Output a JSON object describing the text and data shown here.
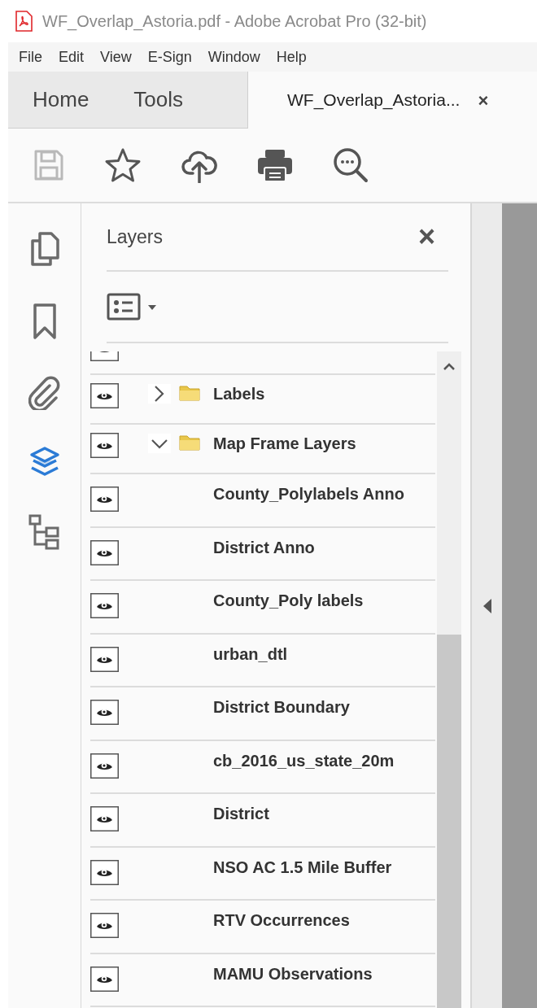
{
  "window": {
    "title": "WF_Overlap_Astoria.pdf - Adobe Acrobat Pro (32-bit)"
  },
  "menu": [
    "File",
    "Edit",
    "View",
    "E-Sign",
    "Window",
    "Help"
  ],
  "tabs": [
    {
      "label": "Home",
      "kind": "nav",
      "selected": false
    },
    {
      "label": "Tools",
      "kind": "nav",
      "selected": false
    },
    {
      "label": "WF_Overlap_Astoria...",
      "kind": "document",
      "selected": true,
      "close": "×"
    }
  ],
  "toolbar": [
    {
      "kind": "save",
      "disabled": true
    },
    {
      "kind": "star",
      "disabled": false
    },
    {
      "kind": "upload",
      "disabled": false
    },
    {
      "kind": "print",
      "disabled": false
    },
    {
      "kind": "zoom",
      "disabled": false
    }
  ],
  "rail": [
    {
      "kind": "pages",
      "selected": false
    },
    {
      "kind": "bookmark",
      "selected": false
    },
    {
      "kind": "attachment",
      "selected": false
    },
    {
      "kind": "layers",
      "selected": true
    },
    {
      "kind": "tree",
      "selected": false
    }
  ],
  "panel": {
    "title": "Layers",
    "close": "×",
    "layers": [
      {
        "kind": "partial",
        "visible": true
      },
      {
        "kind": "folder",
        "name": "Labels",
        "visible": true,
        "expanded": false
      },
      {
        "kind": "folder",
        "name": "Map Frame Layers",
        "visible": true,
        "expanded": true,
        "children": [
          {
            "kind": "layer",
            "name": "County_Polylabels Anno",
            "visible": true
          },
          {
            "kind": "layer",
            "name": "District Anno",
            "visible": true
          },
          {
            "kind": "layer",
            "name": "County_Poly labels",
            "visible": true
          },
          {
            "kind": "layer",
            "name": "urban_dtl",
            "visible": true
          },
          {
            "kind": "layer",
            "name": "District Boundary",
            "visible": true
          },
          {
            "kind": "layer",
            "name": "cb_2016_us_state_20m",
            "visible": true
          },
          {
            "kind": "layer",
            "name": "District",
            "visible": true
          },
          {
            "kind": "layer",
            "name": "NSO AC 1.5 Mile Buffer",
            "visible": true
          },
          {
            "kind": "layer",
            "name": "RTV Occurrences",
            "visible": true
          },
          {
            "kind": "layer",
            "name": "MAMU Observations",
            "visible": true
          }
        ]
      }
    ]
  }
}
